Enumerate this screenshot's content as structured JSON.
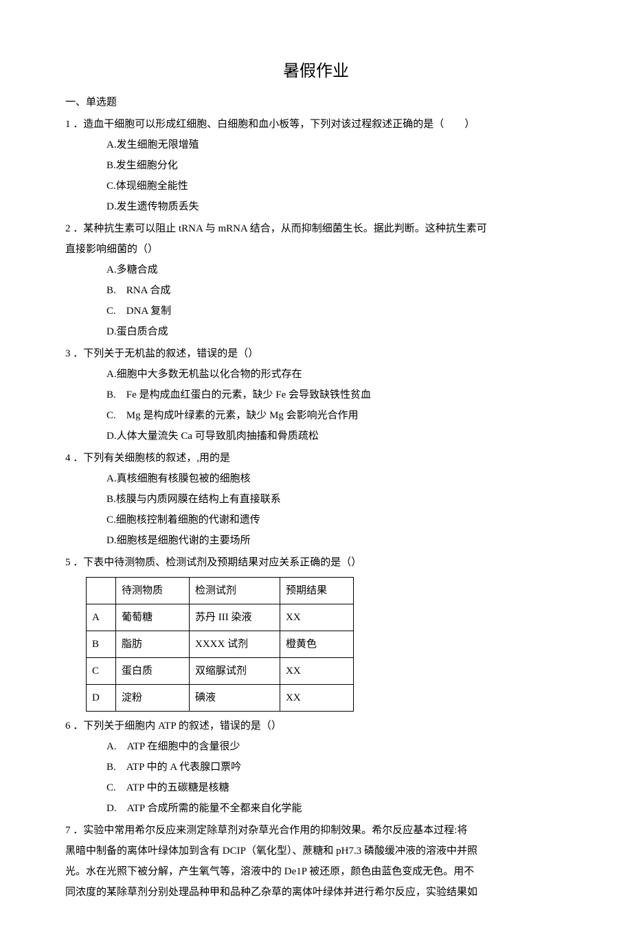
{
  "title": "暑假作业",
  "section1": "一、单选题",
  "q1": {
    "stem": "1 ．造血干细胞可以形成红细胞、白细胞和血小板等，下列对该过程叙述正确的是（　　）",
    "a": "A.发生细胞无限增殖",
    "b": "B.发生细胞分化",
    "c": "C.体现细胞全能性",
    "d": "D.发生遗传物质丢失"
  },
  "q2": {
    "stem1": "2 ．某种抗生素可以阻止 tRNA 与 mRNA 结合，从而抑制细菌生长。据此判断。这种抗生素可",
    "stem2": "直接影响细菌的（）",
    "a": "A.多糖合成",
    "b": "B.　RNA 合成",
    "c": "C.　DNA 复制",
    "d": "D.蛋白质合成"
  },
  "q3": {
    "stem": "3 ．下列关于无机盐的叙述，错误的是（）",
    "a": "A.细胞中大多数无机盐以化合物的形式存在",
    "b": "B.　Fe 是构成血红蛋白的元素，缺少 Fe 会导致缺铁性贫血",
    "c": "C.　Mg 是构成叶绿素的元素，缺少 Mg 会影响光合作用",
    "d": "D.人体大量流失 Ca 可导致肌肉抽搐和骨质疏松"
  },
  "q4": {
    "stem": "4 ．下列有关细胞核的叙述，,用的是",
    "a": "A.真核细胞有核膜包被的细胞核",
    "b": "B.核膜与内质网膜在结构上有直接联系",
    "c": "C.细胞核控制着细胞的代谢和遗传",
    "d": "D.细胞核是细胞代谢的主要场所"
  },
  "q5": {
    "stem": "5 ．下表中待测物质、检测试剂及预期结果对应关系正确的是（）",
    "header": {
      "col1": "",
      "col2": "待测物质",
      "col3": "检测试剂",
      "col4": "预期结果"
    },
    "rows": [
      {
        "k": "A",
        "sub": "葡萄糖",
        "rea": "苏丹 III 染液",
        "res": "XX"
      },
      {
        "k": "B",
        "sub": "脂肪",
        "rea": "XXXX 试剂",
        "res": "橙黄色"
      },
      {
        "k": "C",
        "sub": "蛋白质",
        "rea": "双缩脲试剂",
        "res": "XX"
      },
      {
        "k": "D",
        "sub": "淀粉",
        "rea": "碘液",
        "res": "XX"
      }
    ]
  },
  "q6": {
    "stem": "6 ．下列关于细胞内 ATP 的叙述，错误的是（）",
    "a": "A.　ATP 在细胞中的含量很少",
    "b": "B.　ATP 中的 A 代表腺口票吟",
    "c": "C.　ATP 中的五碳糖是核糖",
    "d": "D.　ATP 合成所需的能量不全都来自化学能"
  },
  "q7": {
    "l1": "7 ．实验中常用希尔反应来测定除草剂对杂草光合作用的抑制效果。希尔反应基本过程:将",
    "l2": "黑暗中制备的离体叶绿体加到含有 DCIP（氧化型）、蔗糖和 pH7.3 磷酸缓冲液的溶液中并照",
    "l3": "光。水在光照下被分解，产生氧气等，溶液中的 De1P 被还原，颜色由蓝色变成无色。用不",
    "l4": "同浓度的某除草剂分别处理品种甲和品种乙杂草的离体叶绿体并进行希尔反应，实验结果如"
  }
}
